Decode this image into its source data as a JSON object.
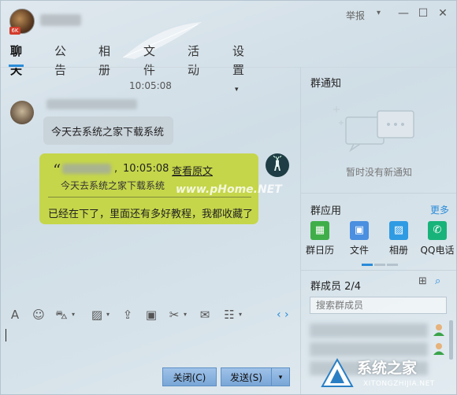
{
  "titlebar": {
    "avatar_badge": "6K",
    "report_label": "举报",
    "report_caret": "▾",
    "minimize_glyph": "—",
    "maximize_glyph": "☐",
    "close_glyph": "✕"
  },
  "tabs": [
    {
      "label": "聊天",
      "active": true
    },
    {
      "label": "公告"
    },
    {
      "label": "相册"
    },
    {
      "label": "文件"
    },
    {
      "label": "活动"
    },
    {
      "label": "设置"
    }
  ],
  "tab_settings_caret": "▾",
  "chat": {
    "timestamp": "10:05:08",
    "incoming_message": "今天去系统之家下载系统",
    "outgoing": {
      "quote_mark": "“",
      "quote_comma": ",",
      "quote_time": "10:05:08",
      "view_original": "查看原文",
      "quote_text": "今天去系统之家下载系统",
      "reply_text": "已经在下了，里面还有多好教程，我都收藏了"
    },
    "overlay_url": "www.pHome.NET"
  },
  "toolbar": {
    "icons": [
      "font-icon",
      "emoji-icon",
      "magic-icon",
      "image-icon",
      "upload-icon",
      "gift-icon",
      "scissors-icon",
      "red-envelope-icon",
      "more-icon"
    ],
    "nav_arrows": "‹ ›"
  },
  "buttons": {
    "close_label": "关闭(C)",
    "send_label": "发送(S)",
    "send_caret": "▾"
  },
  "notice": {
    "title": "群通知",
    "empty_text": "暂时没有新通知"
  },
  "apps": {
    "title": "群应用",
    "more": "更多",
    "items": [
      {
        "label": "群日历",
        "color": "#3fae49",
        "glyph": "▦"
      },
      {
        "label": "文件",
        "color": "#4a8fe0",
        "glyph": "▣"
      },
      {
        "label": "相册",
        "color": "#2f9be3",
        "glyph": "▨"
      },
      {
        "label": "QQ电话",
        "color": "#18b37a",
        "glyph": "✆"
      }
    ]
  },
  "members": {
    "title": "群成员 2/4",
    "search_placeholder": "搜索群成员"
  },
  "brand": {
    "name": "系统之家",
    "sub": "XITONGZHIJIA.NET"
  },
  "colors": {
    "accent": "#2a8cd8",
    "outgoing_bubble": "#c5d64a",
    "incoming_bubble": "#c9d3da"
  }
}
